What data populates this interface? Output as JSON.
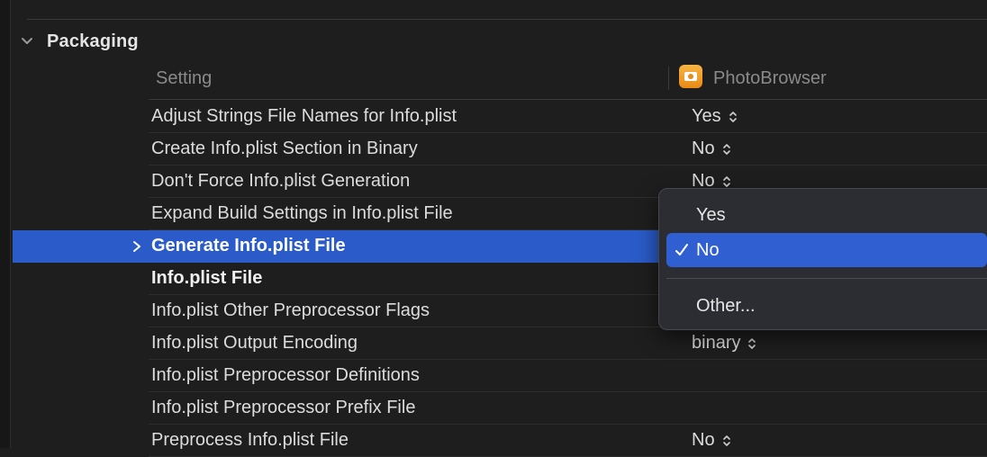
{
  "section": {
    "title": "Packaging"
  },
  "table": {
    "setting_header": "Setting",
    "target_name": "PhotoBrowser"
  },
  "rows": [
    {
      "name": "Adjust Strings File Names for Info.plist",
      "value": "Yes"
    },
    {
      "name": "Create Info.plist Section in Binary",
      "value": "No"
    },
    {
      "name": "Don't Force Info.plist Generation",
      "value": "No"
    },
    {
      "name": "Expand Build Settings in Info.plist File",
      "value": ""
    },
    {
      "name": "Generate Info.plist File",
      "value": ""
    },
    {
      "name": "Info.plist File",
      "value": ""
    },
    {
      "name": "Info.plist Other Preprocessor Flags",
      "value": ""
    },
    {
      "name": "Info.plist Output Encoding",
      "value": "binary"
    },
    {
      "name": "Info.plist Preprocessor Definitions",
      "value": ""
    },
    {
      "name": "Info.plist Preprocessor Prefix File",
      "value": ""
    },
    {
      "name": "Preprocess Info.plist File",
      "value": "No"
    }
  ],
  "popup": {
    "options": [
      "Yes",
      "No",
      "Other..."
    ],
    "selected": "No"
  },
  "colors": {
    "selection": "#2a5bc8",
    "popup_highlight": "#2f5fd1",
    "target_icon": "#f0a030"
  }
}
